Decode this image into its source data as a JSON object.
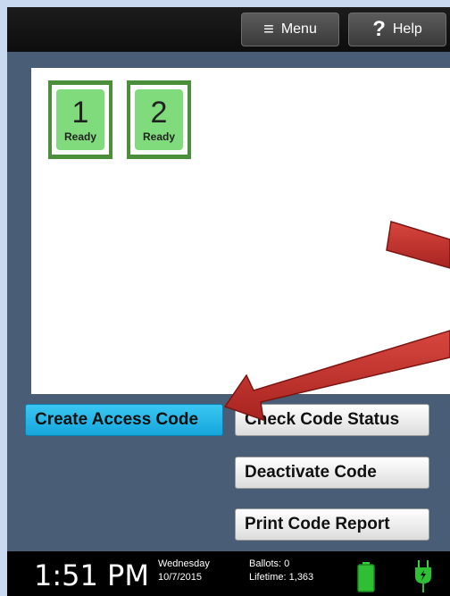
{
  "topbar": {
    "menu_label": "Menu",
    "menu_icon": "hamburger-icon",
    "help_label": "Help",
    "help_icon": "question-icon"
  },
  "cards": [
    {
      "number": "1",
      "status": "Ready"
    },
    {
      "number": "2",
      "status": "Ready"
    }
  ],
  "actions": {
    "create": "Create Access Code",
    "check": "Check Code Status",
    "deactivate": "Deactivate Code",
    "print": "Print Code Report"
  },
  "statusbar": {
    "time": "1:51 PM",
    "day": "Wednesday",
    "date": "10/7/2015",
    "ballots_label": "Ballots:",
    "ballots_value": "0",
    "lifetime_label": "Lifetime:",
    "lifetime_value": "1,363",
    "battery_icon": "battery-icon",
    "power_icon": "plug-icon"
  },
  "colors": {
    "create_button": "#1fb0e4",
    "card_green": "#7fdb7b",
    "card_border": "#4c8f3a",
    "annotation_arrow": "#c0302c"
  }
}
